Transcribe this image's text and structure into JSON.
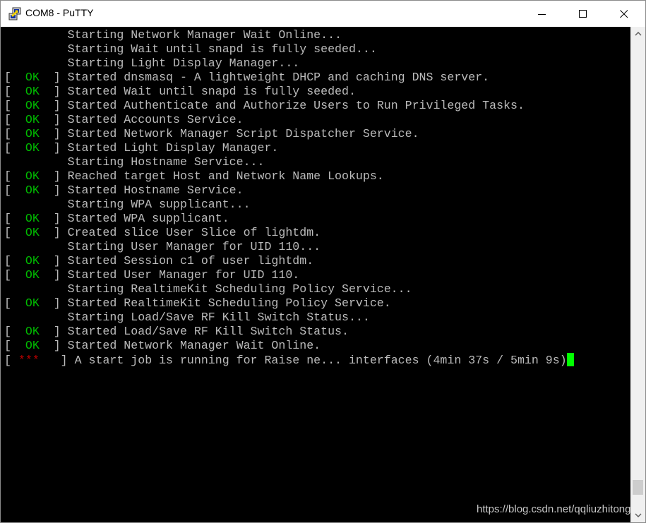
{
  "window": {
    "title": "COM8 - PuTTY",
    "icon": "putty-icon",
    "controls": [
      "minimize-icon",
      "maximize-icon",
      "close-icon"
    ]
  },
  "terminal": {
    "lines": [
      {
        "status": "",
        "text": "Starting Network Manager Wait Online..."
      },
      {
        "status": "",
        "text": "Starting Wait until snapd is fully seeded..."
      },
      {
        "status": "",
        "text": "Starting Light Display Manager..."
      },
      {
        "status": "OK",
        "text": "Started dnsmasq - A lightweight DHCP and caching DNS server."
      },
      {
        "status": "OK",
        "text": "Started Wait until snapd is fully seeded."
      },
      {
        "status": "OK",
        "text": "Started Authenticate and Authorize Users to Run Privileged Tasks."
      },
      {
        "status": "OK",
        "text": "Started Accounts Service."
      },
      {
        "status": "OK",
        "text": "Started Network Manager Script Dispatcher Service."
      },
      {
        "status": "OK",
        "text": "Started Light Display Manager."
      },
      {
        "status": "",
        "text": "Starting Hostname Service..."
      },
      {
        "status": "OK",
        "text": "Reached target Host and Network Name Lookups."
      },
      {
        "status": "OK",
        "text": "Started Hostname Service."
      },
      {
        "status": "",
        "text": "Starting WPA supplicant..."
      },
      {
        "status": "OK",
        "text": "Started WPA supplicant."
      },
      {
        "status": "OK",
        "text": "Created slice User Slice of lightdm."
      },
      {
        "status": "",
        "text": "Starting User Manager for UID 110..."
      },
      {
        "status": "OK",
        "text": "Started Session c1 of user lightdm."
      },
      {
        "status": "OK",
        "text": "Started User Manager for UID 110."
      },
      {
        "status": "",
        "text": "Starting RealtimeKit Scheduling Policy Service..."
      },
      {
        "status": "OK",
        "text": "Started RealtimeKit Scheduling Policy Service."
      },
      {
        "status": "",
        "text": "Starting Load/Save RF Kill Switch Status..."
      },
      {
        "status": "OK",
        "text": "Started Load/Save RF Kill Switch Status."
      },
      {
        "status": "OK",
        "text": "Started Network Manager Wait Online."
      },
      {
        "status": "***",
        "text": "A start job is running for Raise ne... interfaces (4min 37s / 5min 9s)"
      }
    ],
    "colors": {
      "text": "#bbbbbb",
      "ok": "#00bb00",
      "busy": "#bb0000",
      "cursor": "#00ff00",
      "background": "#000000"
    }
  },
  "scrollbar": {
    "position_fraction": 0.97
  },
  "watermark": "https://blog.csdn.net/qqliuzhitong"
}
